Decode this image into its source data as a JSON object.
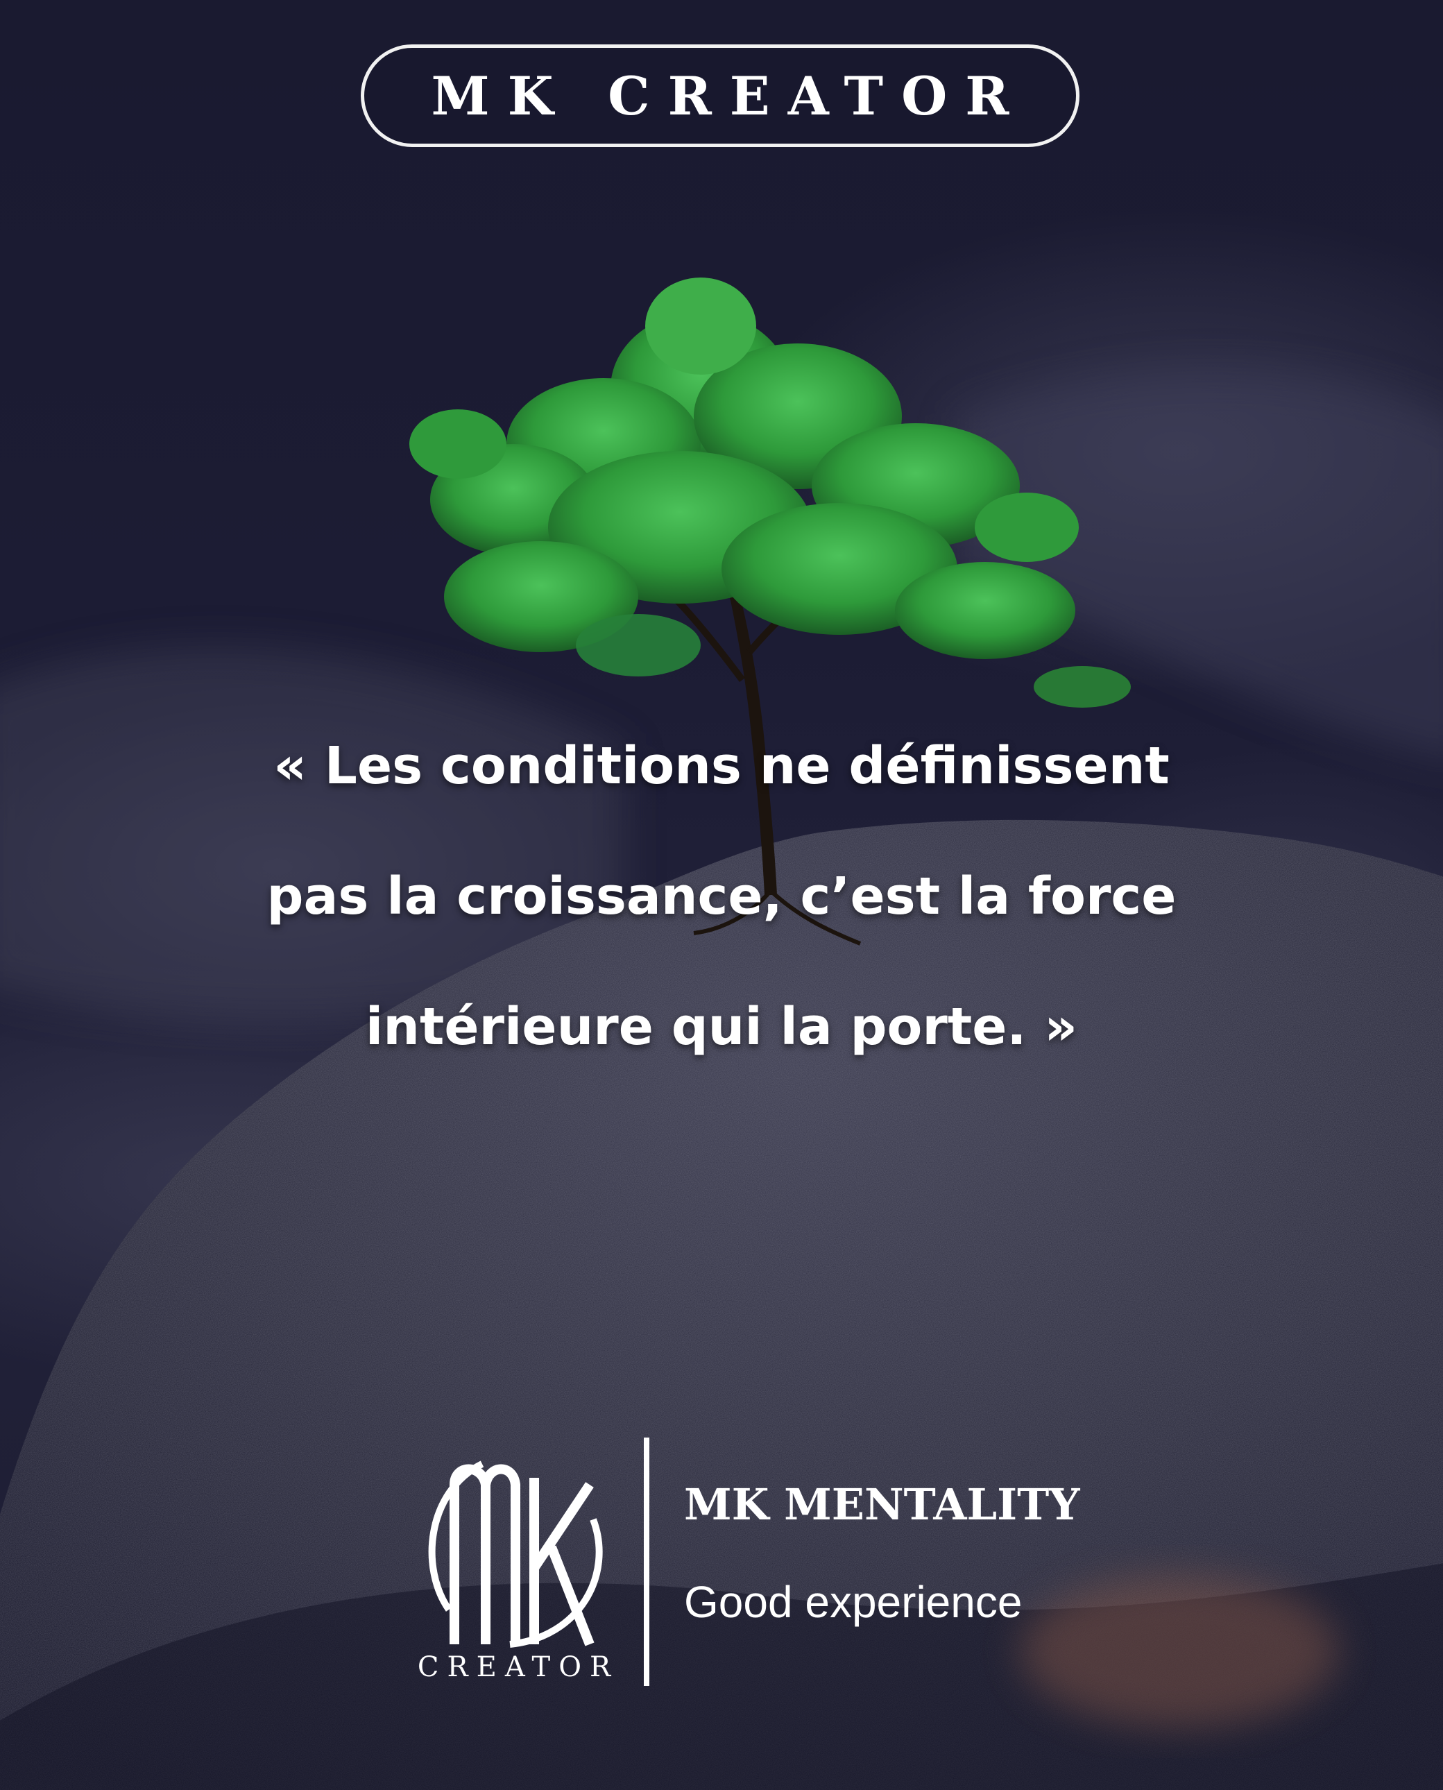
{
  "header": {
    "title": "MK CREATOR"
  },
  "quote": {
    "line1": "« Les conditions ne définissent",
    "line2": "pas la croissance, c’est la force",
    "line3": "intérieure qui la porte. »"
  },
  "branding": {
    "logo_caption": "CREATOR",
    "name": "MK MENTALITY",
    "tagline": "Good experience"
  },
  "image": {
    "subject": "green tree growing on dark rock"
  },
  "colors": {
    "background": "#1a1a30",
    "rock": "#2a2a3c",
    "foliage": "#2e9a3a",
    "text": "#ffffff"
  }
}
